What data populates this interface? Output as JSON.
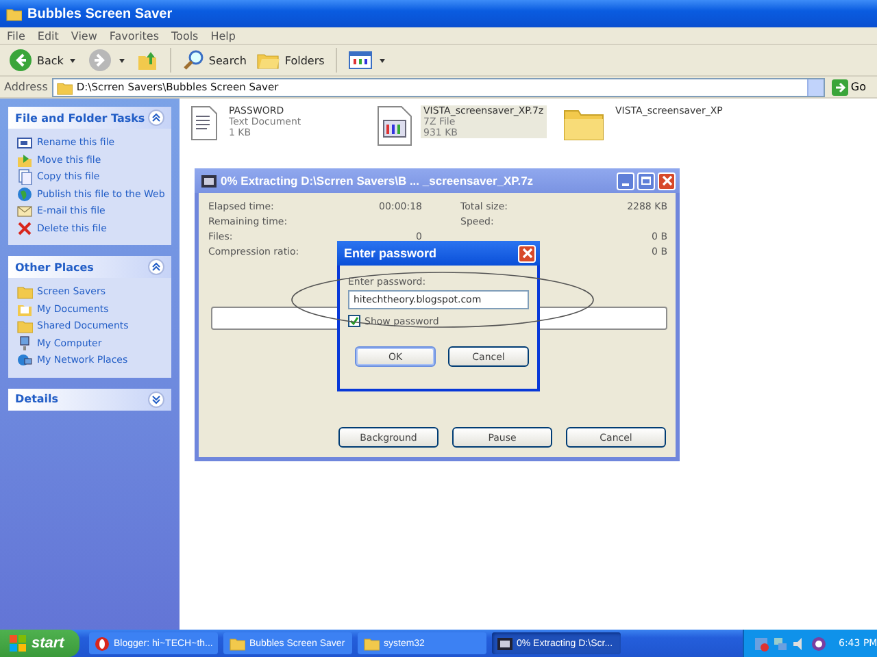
{
  "explorer": {
    "title": "Bubbles Screen Saver",
    "menu": [
      "File",
      "Edit",
      "View",
      "Favorites",
      "Tools",
      "Help"
    ],
    "toolbar": [
      {
        "kind": "back",
        "label": "Back"
      },
      {
        "kind": "forward"
      },
      {
        "kind": "up"
      },
      {
        "kind": "search",
        "label": "Search"
      },
      {
        "kind": "folders",
        "label": "Folders"
      },
      {
        "kind": "views"
      }
    ],
    "address": {
      "label": "Address",
      "value": "D:\\Scrren Savers\\Bubbles Screen Saver",
      "go": "Go"
    },
    "panels": [
      {
        "title": "File and Folder Tasks",
        "expanded": true,
        "items": [
          {
            "label": "Rename this file"
          },
          {
            "label": "Move this file"
          },
          {
            "label": "Copy this file"
          },
          {
            "label": "Publish this file to the Web"
          },
          {
            "label": "E-mail this file"
          },
          {
            "label": "Delete this file"
          }
        ]
      },
      {
        "title": "Other Places",
        "expanded": true,
        "items": [
          {
            "label": "Screen Savers"
          },
          {
            "label": "My Documents"
          },
          {
            "label": "Shared Documents"
          },
          {
            "label": "My Computer"
          },
          {
            "label": "My Network Places"
          }
        ]
      },
      {
        "title": "Details",
        "expanded": false
      }
    ],
    "files": [
      {
        "kind": "text",
        "name": "PASSWORD",
        "type": "Text Document",
        "size": "1 KB",
        "selected": false
      },
      {
        "kind": "archive",
        "name": "VISTA_screensaver_XP.7z",
        "type": "7Z File",
        "size": "931 KB",
        "selected": true
      },
      {
        "kind": "folder",
        "name": "VISTA_screensaver_XP",
        "selected": false
      }
    ]
  },
  "extract_dialog": {
    "title": "0% Extracting D:\\Scrren Savers\\B ... _screensaver_XP.7z",
    "stats_left": [
      {
        "label": "Elapsed time:",
        "value": "00:00:18"
      },
      {
        "label": "Remaining time:"
      },
      {
        "label": "Files:",
        "value": "0"
      },
      {
        "label": "Compression ratio:"
      }
    ],
    "stats_right": [
      {
        "label": "Total size:",
        "value": "2288 KB"
      },
      {
        "label": "Speed:"
      },
      {
        "value": "0 B"
      },
      {
        "value": "0 B"
      }
    ],
    "progress": {
      "level": 0
    },
    "buttons": [
      "Background",
      "Pause",
      "Cancel"
    ]
  },
  "password_dialog": {
    "title": "Enter password",
    "prompt": "Enter password:",
    "value": "hitechtheory.blogspot.com",
    "show_password": {
      "label": "Show password",
      "checked": true
    },
    "buttons": [
      {
        "label": "OK",
        "default": true
      },
      {
        "label": "Cancel",
        "default": false
      }
    ]
  },
  "taskbar": {
    "start": "start",
    "items": [
      {
        "kind": "browser",
        "label": "Blogger: hi~TECH~th...",
        "selected": false
      },
      {
        "kind": "folder",
        "label": "Bubbles Screen Saver",
        "selected": false
      },
      {
        "kind": "folder",
        "label": "system32",
        "selected": false
      },
      {
        "kind": "archive",
        "label": "0% Extracting D:\\Scr...",
        "selected": true
      }
    ],
    "clock": "6:43 PM"
  }
}
